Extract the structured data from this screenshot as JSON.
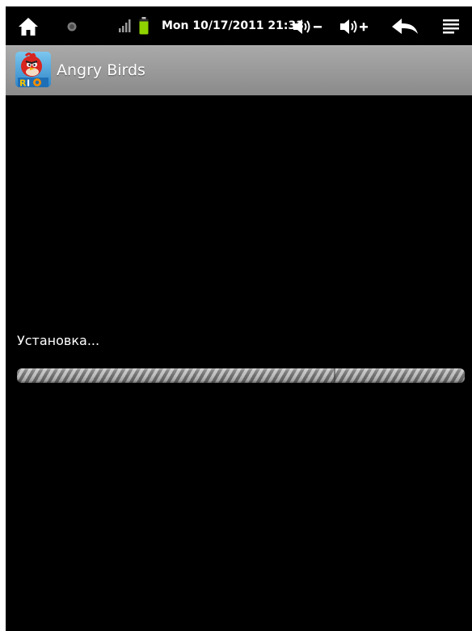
{
  "statusbar": {
    "datetime": "Mon 10/17/2011 21:33",
    "icons": [
      "home-icon",
      "notification-dot-icon",
      "signal-icon",
      "battery-icon",
      "volume-down-icon",
      "volume-up-icon",
      "back-icon",
      "menu-icon"
    ],
    "battery_color": "#8fd400"
  },
  "titlebar": {
    "app_name": "Angry Birds",
    "icon": "angry-birds-rio-icon"
  },
  "content": {
    "status_text": "Установка...",
    "progress": {
      "indeterminate": true,
      "color": "#9e9e9e"
    }
  }
}
